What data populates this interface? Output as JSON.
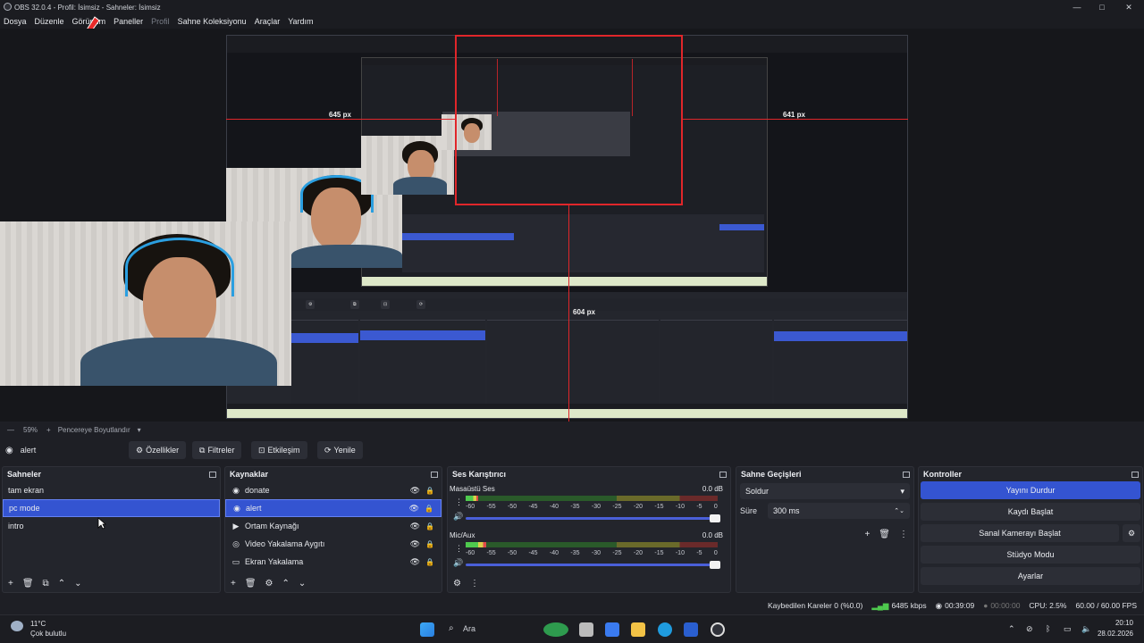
{
  "window": {
    "title": "OBS 32.0.4 - Profil: İsimsiz - Sahneler: İsimsiz",
    "minimize": "—",
    "maximize": "□",
    "close": "✕"
  },
  "menu": {
    "items": [
      "Dosya",
      "Düzenle",
      "Görünüm",
      "Paneller",
      "Profil",
      "Sahne Koleksiyonu",
      "Araçlar",
      "Yardım"
    ]
  },
  "preview": {
    "measure_left": "645 px",
    "measure_right": "641 px",
    "measure_bottom": "604 px"
  },
  "zoom": {
    "level": "59%",
    "mode": "Pencereye Boyutlandır"
  },
  "source_toolbar": {
    "current_source": "alert",
    "properties": "Özellikler",
    "filters": "Filtreler",
    "interact": "Etkileşim",
    "refresh": "Yenile"
  },
  "scenes": {
    "title": "Sahneler",
    "items": [
      {
        "label": "tam ekran",
        "selected": false
      },
      {
        "label": "pc mode",
        "selected": true
      },
      {
        "label": "intro",
        "selected": false
      }
    ]
  },
  "sources": {
    "title": "Kaynaklar",
    "items": [
      {
        "label": "donate",
        "icon": "globe-icon",
        "selected": false
      },
      {
        "label": "alert",
        "icon": "globe-icon",
        "selected": true
      },
      {
        "label": "Ortam Kaynağı",
        "icon": "play-icon",
        "selected": false
      },
      {
        "label": "Video Yakalama Aygıtı",
        "icon": "camera-icon",
        "selected": false
      },
      {
        "label": "Ekran Yakalama",
        "icon": "monitor-icon",
        "selected": false
      }
    ]
  },
  "mixer": {
    "title": "Ses Karıştırıcı",
    "channels": [
      {
        "name": "Masaüstü Ses",
        "db": "0.0 dB",
        "level": 0.05
      },
      {
        "name": "Mic/Aux",
        "db": "0.0 dB",
        "level": 0.08
      }
    ],
    "ticks": [
      "-60",
      "-55",
      "-50",
      "-45",
      "-40",
      "-35",
      "-30",
      "-25",
      "-20",
      "-15",
      "-10",
      "-5",
      "0"
    ]
  },
  "transitions": {
    "title": "Sahne Geçişleri",
    "selected": "Soldur",
    "duration_label": "Süre",
    "duration_value": "300 ms"
  },
  "controls": {
    "title": "Kontroller",
    "stop_stream": "Yayını Durdur",
    "start_record": "Kaydı Başlat",
    "virtual_cam": "Sanal Kamerayı Başlat",
    "studio_mode": "Stüdyo Modu",
    "settings": "Ayarlar"
  },
  "status": {
    "dropped": "Kaybedilen Kareler 0 (%0.0)",
    "bitrate": "6485 kbps",
    "stream_time": "00:39:09",
    "record_time": "00:00:00",
    "cpu": "CPU: 2.5%",
    "fps": "60.00 / 60.00 FPS"
  },
  "taskbar": {
    "weather_temp": "11°C",
    "weather_desc": "Çok bulutlu",
    "search": "Ara",
    "time": "20:10",
    "date": "28.02.2026"
  },
  "colors": {
    "accent": "#3454d1",
    "measure_red": "#e0262a"
  }
}
